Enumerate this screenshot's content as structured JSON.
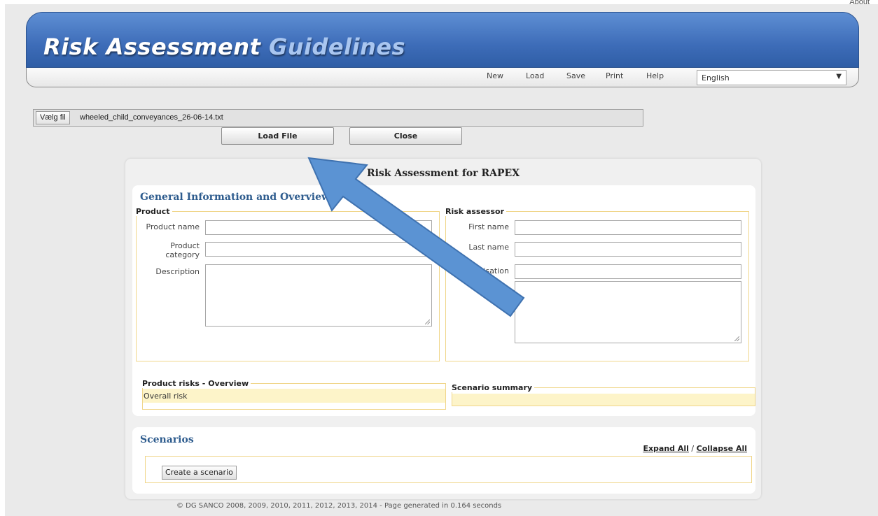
{
  "header": {
    "about": "About",
    "title_main": "Risk Assessment ",
    "title_sub": "Guidelines",
    "menu": [
      "New",
      "Load",
      "Save",
      "Print",
      "Help"
    ],
    "language": "English"
  },
  "file_upload": {
    "choose_label": "Vælg fil",
    "file_name": "wheeled_child_conveyances_26-06-14.txt",
    "load_button": "Load File",
    "close_button": "Close"
  },
  "panel": {
    "title": "Risk Assessment for RAPEX",
    "general": {
      "heading": "General Information and Overview",
      "product": {
        "legend": "Product",
        "name_label": "Product name",
        "category_label": "Product category",
        "description_label": "Description"
      },
      "assessor": {
        "legend": "Risk assessor",
        "first_name_label": "First name",
        "last_name_label": "Last name",
        "organisation_label": "Organisation"
      },
      "risks_legend": "Product risks - Overview",
      "overall_risk": "Overall risk",
      "scenario_summary_legend": "Scenario summary"
    },
    "scenarios": {
      "heading": "Scenarios",
      "expand_all": "Expand All",
      "separator": " / ",
      "collapse_all": "Collapse All",
      "create_button": "Create a scenario"
    }
  },
  "footer": "© DG SANCO 2008, 2009, 2010, 2011, 2012, 2013, 2014 - Page generated in 0.164 seconds",
  "colors": {
    "banner": "#3d6cb8",
    "heading": "#2e5c8e",
    "fieldset_border": "#f0d68a",
    "arrow": "#5b93d3"
  }
}
